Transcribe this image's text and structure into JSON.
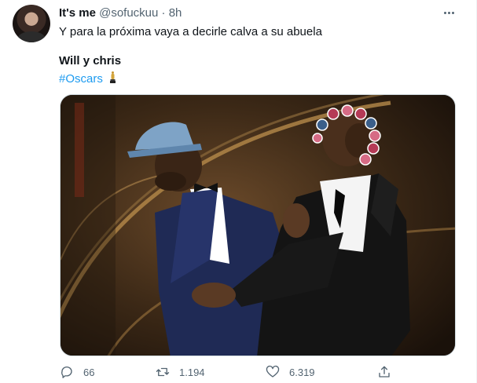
{
  "tweet": {
    "display_name": "It's me",
    "handle": "@sofuckuu",
    "separator": "·",
    "time": "8h",
    "text_line1": "Y para la próxima vaya a decirle calva a su abuela",
    "text_line2": "Will y chris",
    "hashtag": "#Oscars"
  },
  "actions": {
    "reply_count": "66",
    "retweet_count": "1.194",
    "like_count": "6.319"
  },
  "icons": {
    "more": "more-horizontal-icon",
    "reply": "reply-icon",
    "retweet": "retweet-icon",
    "like": "heart-icon",
    "share": "share-icon",
    "trophy": "trophy-emoji"
  },
  "colors": {
    "link": "#1d9bf0",
    "secondary_text": "#536471"
  }
}
